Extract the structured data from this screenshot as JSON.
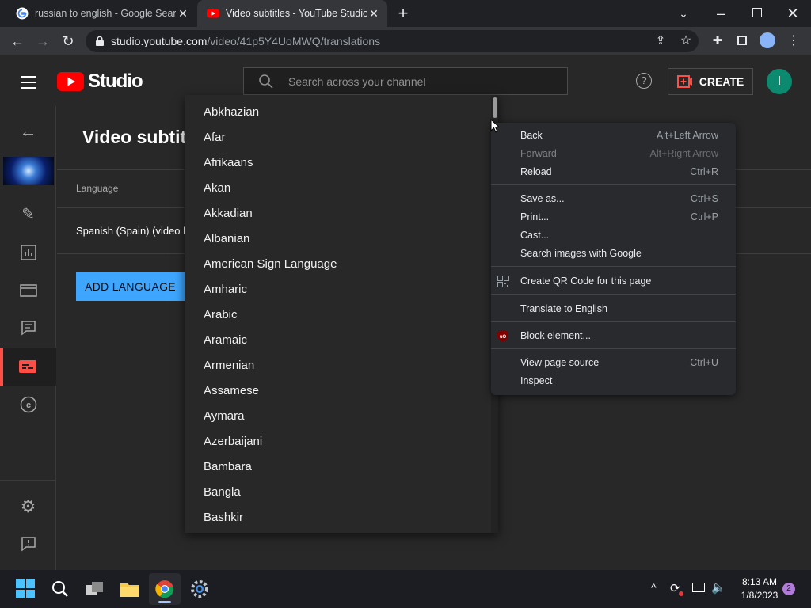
{
  "browser": {
    "tabs": [
      {
        "title": "russian to english - Google Search",
        "active": false
      },
      {
        "title": "Video subtitles - YouTube Studio",
        "active": true
      }
    ],
    "url_host": "studio.youtube.com",
    "url_path": "/video/41p5Y4UoMWQ/translations"
  },
  "studio": {
    "logo_text": "Studio",
    "search_placeholder": "Search across your channel",
    "create_label": "CREATE",
    "avatar_letter": "I",
    "page_title": "Video subtit",
    "column_language": "Language",
    "row_language": "Spanish (Spain) (video l",
    "add_language_label": "ADD LANGUAGE"
  },
  "dropdown": {
    "languages": [
      "Abkhazian",
      "Afar",
      "Afrikaans",
      "Akan",
      "Akkadian",
      "Albanian",
      "American Sign Language",
      "Amharic",
      "Arabic",
      "Aramaic",
      "Armenian",
      "Assamese",
      "Aymara",
      "Azerbaijani",
      "Bambara",
      "Bangla",
      "Bashkir"
    ]
  },
  "context_menu": {
    "items": [
      {
        "label": "Back",
        "shortcut": "Alt+Left Arrow",
        "disabled": false
      },
      {
        "label": "Forward",
        "shortcut": "Alt+Right Arrow",
        "disabled": true
      },
      {
        "label": "Reload",
        "shortcut": "Ctrl+R",
        "disabled": false
      },
      {
        "label": "Save as...",
        "shortcut": "Ctrl+S",
        "disabled": false
      },
      {
        "label": "Print...",
        "shortcut": "Ctrl+P",
        "disabled": false
      },
      {
        "label": "Cast...",
        "shortcut": "",
        "disabled": false
      },
      {
        "label": "Search images with Google",
        "shortcut": "",
        "disabled": false
      },
      {
        "label": "Create QR Code for this page",
        "shortcut": "",
        "disabled": false
      },
      {
        "label": "Translate to English",
        "shortcut": "",
        "disabled": false
      },
      {
        "label": "Block element...",
        "shortcut": "",
        "disabled": false
      },
      {
        "label": "View page source",
        "shortcut": "Ctrl+U",
        "disabled": false
      },
      {
        "label": "Inspect",
        "shortcut": "",
        "disabled": false
      }
    ]
  },
  "taskbar": {
    "time": "8:13 AM",
    "date": "1/8/2023",
    "notification_count": "2"
  },
  "colors": {
    "accent_blue": "#3ea6ff",
    "youtube_red": "#ff0000",
    "avatar_green": "#0b8a6f",
    "active_nav_red": "#ff4e45"
  }
}
